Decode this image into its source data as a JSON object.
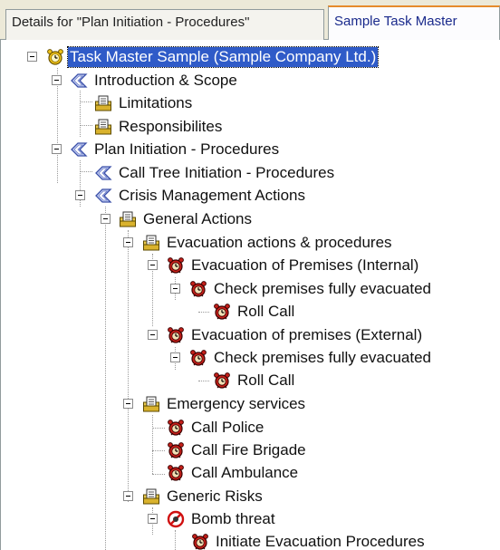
{
  "tabs": [
    {
      "label": "Details for \"Plan Initiation - Procedures\"",
      "active": false
    },
    {
      "label": "Sample Task Master",
      "active": true
    }
  ],
  "tree": {
    "root": "Task Master Sample (Sample Company Ltd.)",
    "introduction": "Introduction & Scope",
    "limitations": "Limitations",
    "responsibilities": "Responsibilites",
    "plan_initiation": "Plan Initiation - Procedures",
    "call_tree": "Call Tree Initiation -  Procedures",
    "crisis_actions": "Crisis Management Actions",
    "general_actions": "General Actions",
    "evacuation_actions": "Evacuation actions & procedures",
    "evac_internal": "Evacuation of Premises (Internal)",
    "check_internal": "Check premises fully evacuated",
    "roll_call_internal": "Roll Call",
    "evac_external": "Evacuation of premises (External)",
    "check_external": "Check premises fully evacuated",
    "roll_call_external": "Roll Call",
    "emergency_services": "Emergency services",
    "call_police": "Call Police",
    "call_fire": "Call Fire Brigade",
    "call_ambulance": "Call Ambulance",
    "generic_risks": "Generic Risks",
    "bomb_threat": "Bomb threat",
    "initiate_evac": "Initiate Evacuation Procedures"
  },
  "icons": {
    "root": "alarm-clock-gold-icon",
    "section": "diamond-tag-icon",
    "document": "folder-document-icon",
    "task": "red-alarm-clock-icon",
    "threat": "red-no-symbol-icon"
  },
  "colors": {
    "selection": "#2f5bc8",
    "active_tab_text": "#1a2a8c",
    "active_tab_accent": "#e68b2c",
    "task_red": "#c8201a",
    "section_blue": "#3a4fa8",
    "folder_yellow": "#e8c84a"
  }
}
